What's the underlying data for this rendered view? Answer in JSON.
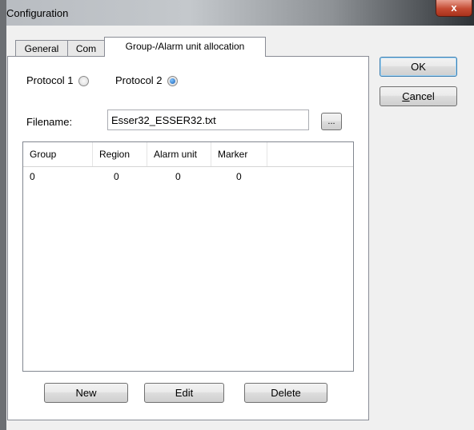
{
  "window": {
    "title": "Configuration",
    "close_glyph": "x"
  },
  "tabs": [
    {
      "label": "General"
    },
    {
      "label": "Com"
    },
    {
      "label": "Group-/Alarm unit allocation"
    }
  ],
  "protocol": {
    "option1_label": "Protocol 1",
    "option2_label": "Protocol 2",
    "selected": "Protocol 2"
  },
  "filename": {
    "label": "Filename:",
    "value": "Esser32_ESSER32.txt",
    "browse_label": "..."
  },
  "table": {
    "columns": [
      "Group",
      "Region",
      "Alarm unit",
      "Marker"
    ],
    "rows": [
      [
        "0",
        "0",
        "0",
        "0"
      ]
    ]
  },
  "list_buttons": {
    "new": "New",
    "edit": "Edit",
    "delete": "Delete"
  },
  "dialog_buttons": {
    "ok": "OK",
    "cancel": "Cancel",
    "cancel_mnemonic": "C"
  },
  "icons": {
    "close": "close-icon",
    "radio": "radio-icon"
  },
  "colors": {
    "title_close": "#c44a32",
    "radio_checked": "#1a5fb4",
    "focus_border": "#3c7fb1"
  }
}
